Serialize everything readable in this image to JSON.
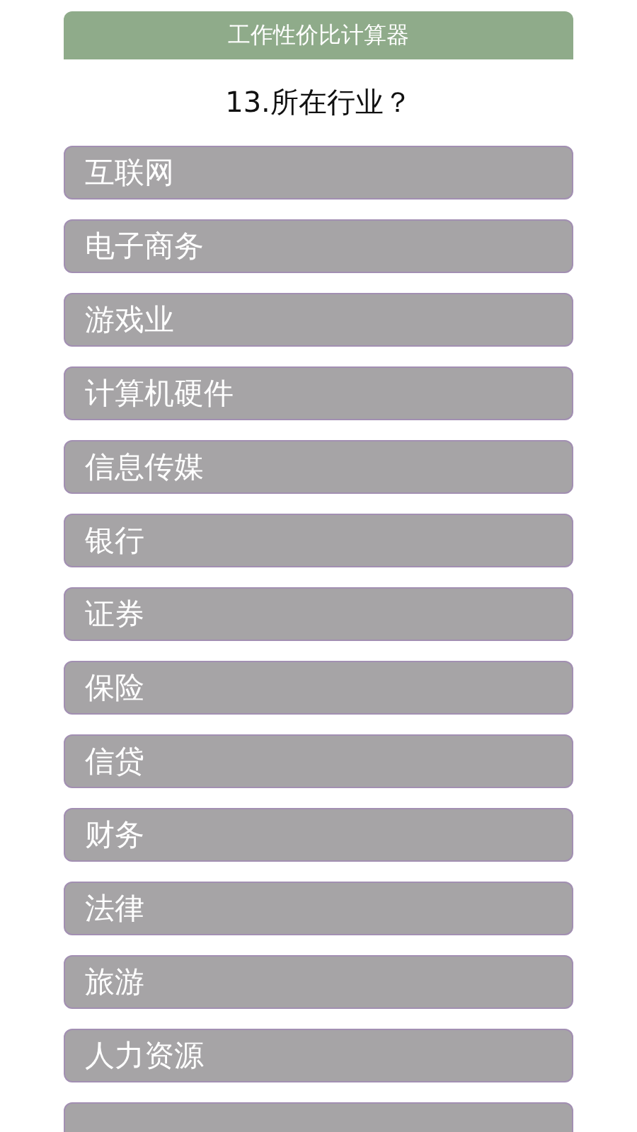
{
  "header": {
    "title": "工作性价比计算器"
  },
  "question": "13.所在行业？",
  "options": [
    {
      "label": "互联网"
    },
    {
      "label": "电子商务"
    },
    {
      "label": "游戏业"
    },
    {
      "label": "计算机硬件"
    },
    {
      "label": "信息传媒"
    },
    {
      "label": "银行"
    },
    {
      "label": "证券"
    },
    {
      "label": "保险"
    },
    {
      "label": "信贷"
    },
    {
      "label": "财务"
    },
    {
      "label": "法律"
    },
    {
      "label": "旅游"
    },
    {
      "label": "人力资源"
    }
  ],
  "more_below": true
}
